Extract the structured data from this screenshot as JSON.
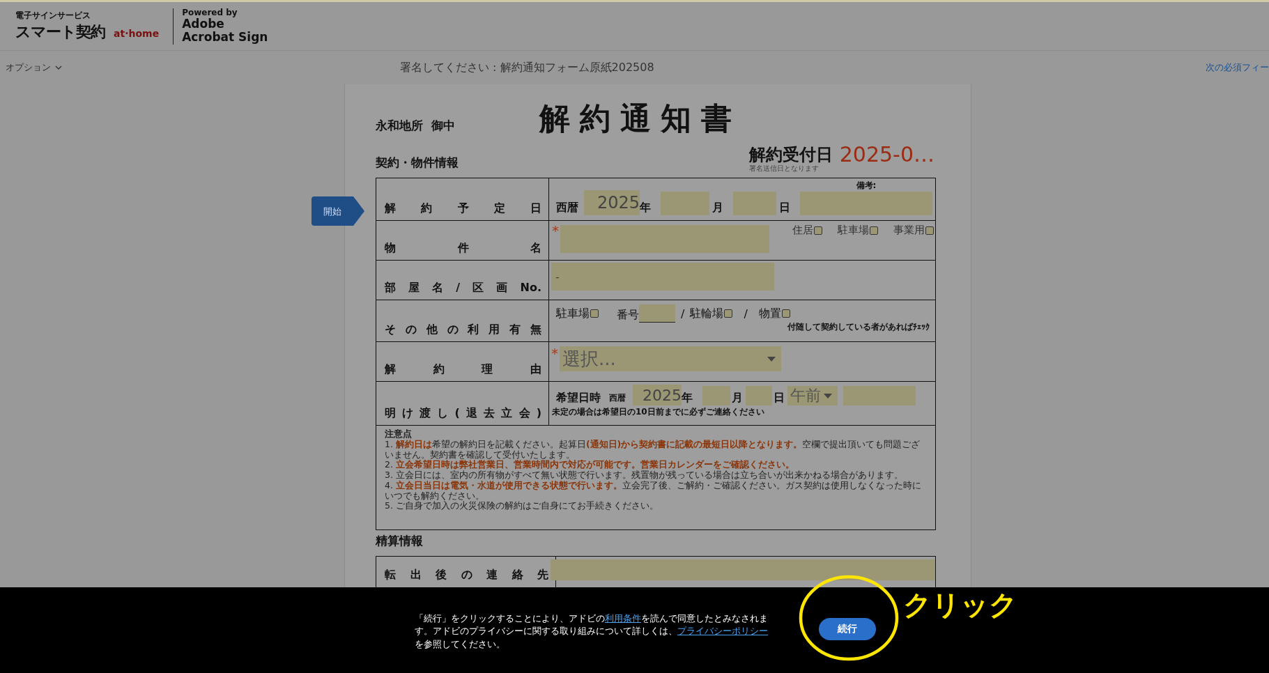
{
  "header": {
    "logo_caption": "電子サインサービス",
    "logo_main": "スマート契約",
    "logo_brand": "at·home",
    "powered_by": "Powered by",
    "product_lines": [
      "Adobe",
      "Acrobat Sign"
    ]
  },
  "toolbar": {
    "options": "オプション",
    "title": "署名してください : 解約通知フォーム原紙202508",
    "next_link": "次の必須フィー"
  },
  "start_tag": "開始",
  "document": {
    "addressee": "永和地所  御中",
    "title": "解約通知書",
    "receipt": {
      "label": "解約受付日",
      "value": "2025-0…",
      "hint": "署名送信日となります"
    },
    "sections": [
      {
        "heading": "契約・物件情報",
        "rows": [
          {
            "kind": "date",
            "label": "解約予定日",
            "era": "西暦",
            "year": "2025",
            "year_unit": "年",
            "month_unit": "月",
            "day_unit": "日",
            "note_label": "備考:"
          },
          {
            "kind": "property",
            "label": "物件名",
            "required_mark": "*",
            "options": [
              {
                "label": "住居",
                "checked": false
              },
              {
                "label": "駐車場",
                "checked": false
              },
              {
                "label": "事業用",
                "checked": false
              }
            ]
          },
          {
            "kind": "room",
            "label": "部屋名/区画No.",
            "value": "-"
          },
          {
            "kind": "other_use",
            "label": "その他の利用有無",
            "parking": {
              "label": "駐車場",
              "checked": false
            },
            "number_label": "番号",
            "separator": "/",
            "bicycle": {
              "label": "駐輪場",
              "checked": false
            },
            "separator_2": "/",
            "storage": {
              "label": "物置",
              "checked": false
            },
            "note": "付随して契約している者があればﾁｪｯｸ"
          },
          {
            "kind": "reason",
            "label": "解約理由",
            "required_mark": "*",
            "value": "選択..."
          },
          {
            "kind": "moveout",
            "label": "明け渡し(退去立会)",
            "heading": "希望日時",
            "era": "西暦",
            "year": "2025",
            "year_unit": "年",
            "month_unit": "月",
            "day_unit": "日",
            "period": "午前",
            "note": "未定の場合は希望日の10日前までに必ずご連絡ください"
          },
          {
            "kind": "notes",
            "title": "注意点",
            "items": [
              "1. **解約日は**希望の解約日を記載ください。起算日**(通知日)から契約書に記載の最短日以降となります。**空欄で提出頂いても問題ございません。契約書を確認して受付いたします。",
              "2. **立会希望日時は弊社営業日、営業時間内で対応が可能です。営業日カレンダーをご確認ください。**",
              "3. 立会日には、室内の所有物がすべて無い状態で行います。残置物が残っている場合は立ち合いが出来かねる場合があります。",
              "4. **立会日当日は電気・水道が使用できる状態で行います。**立会完了後、ご解約・ご確認ください。ガス契約は使用しなくなった時にいつでも解約ください。",
              "5. ご自身で加入の火災保険の解約はご自身にてお手続きください。"
            ]
          }
        ]
      },
      {
        "heading": "精算情報",
        "rows": [
          {
            "kind": "contact",
            "label": "転出後の連絡先"
          }
        ]
      }
    ]
  },
  "consent": {
    "parts": [
      {
        "kind": "text",
        "text": "「続行」をクリックすることにより、アドビの"
      },
      {
        "kind": "link",
        "text": "利用条件"
      },
      {
        "kind": "text",
        "text": "を読んで同意したとみなされます。アドビのプライバシーに関する取り組みについて詳しくは、"
      },
      {
        "kind": "link",
        "text": "プライバシーポリシー"
      },
      {
        "kind": "text",
        "text": "を参照してください。"
      }
    ],
    "button": "続行"
  },
  "annotation": {
    "label": "クリック"
  }
}
